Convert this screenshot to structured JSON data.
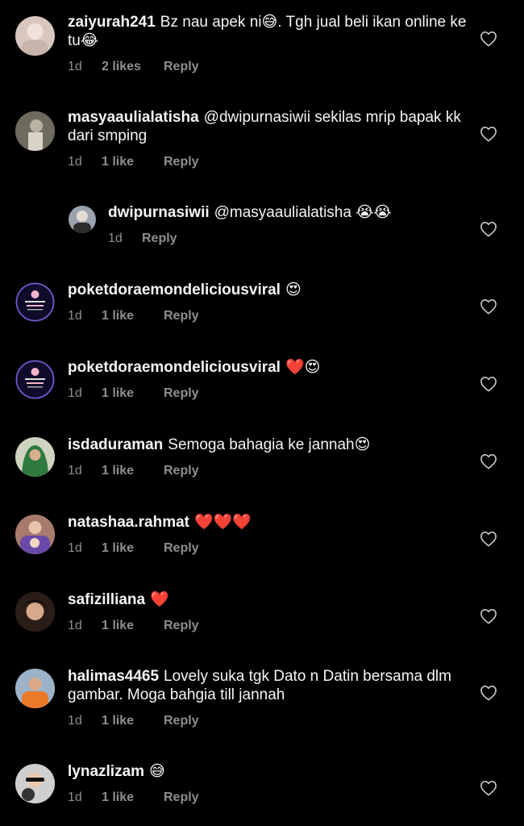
{
  "comments": [
    {
      "user": "zaiyurah241",
      "text": "Bz nau apek ni😅. Tgh jual beli ikan online ke tu😂",
      "time": "1d",
      "likes": "2 likes",
      "reply": "Reply",
      "avatar_color": "#d9c7bf"
    },
    {
      "user": "masyaaulialatisha",
      "text": "@dwipurnasiwii  sekilas mrip bapak kk dari smping",
      "time": "1d",
      "likes": "1 like",
      "reply": "Reply",
      "avatar_color": "#8e8a7a"
    },
    {
      "user": "dwipurnasiwii",
      "text": "@masyaaulialatisha 😭😭",
      "time": "1d",
      "likes": "",
      "reply": "Reply",
      "avatar_color": "#9aa3ad"
    },
    {
      "user": "poketdoraemondeliciousviral",
      "text": "😍",
      "time": "1d",
      "likes": "1 like",
      "reply": "Reply",
      "avatar_color": "#1b1a3a"
    },
    {
      "user": "poketdoraemondeliciousviral",
      "text": "❤️😍",
      "time": "1d",
      "likes": "1 like",
      "reply": "Reply",
      "avatar_color": "#1b1a3a"
    },
    {
      "user": "isdaduraman",
      "text": "Semoga bahagia ke jannah😍",
      "time": "1d",
      "likes": "1 like",
      "reply": "Reply",
      "avatar_color": "#3f7a3d"
    },
    {
      "user": "natashaa.rahmat",
      "text": "❤️❤️❤️",
      "time": "1d",
      "likes": "1 like",
      "reply": "Reply",
      "avatar_color": "#c29a8f"
    },
    {
      "user": "safizilliana",
      "text": "❤️",
      "time": "1d",
      "likes": "1 like",
      "reply": "Reply",
      "avatar_color": "#6f4f42"
    },
    {
      "user": "halimas4465",
      "text": "Lovely suka tgk Dato n Datin bersama dlm gambar. Moga bahgia till jannah",
      "time": "1d",
      "likes": "1 like",
      "reply": "Reply",
      "avatar_color": "#e3a35a"
    },
    {
      "user": "lynazlizam",
      "text": "😅",
      "time": "1d",
      "likes": "1 like",
      "reply": "Reply",
      "avatar_color": "#7a7a7a"
    }
  ],
  "icons": {
    "like": "heart-outline-icon"
  }
}
